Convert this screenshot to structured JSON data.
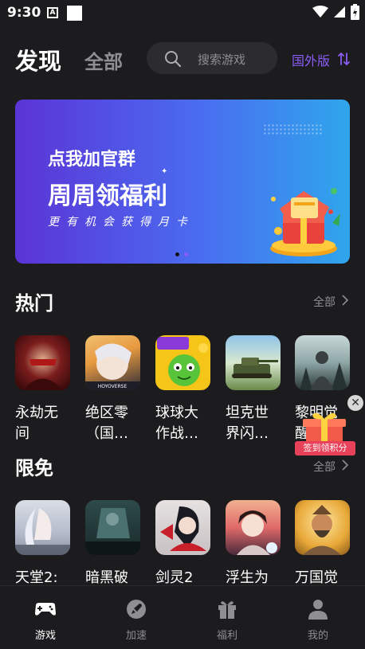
{
  "status_bar": {
    "time": "9:30",
    "a_icon_letter": "A"
  },
  "header": {
    "tab_discover": "发现",
    "tab_all": "全部",
    "search_placeholder": "搜索游戏",
    "region": "国外版"
  },
  "banner": {
    "line1": "点我加官群",
    "line2": "周周领福利",
    "line3": "更有机会获得月卡",
    "pager_count": 2,
    "pager_active": 1
  },
  "sections": {
    "hot": {
      "title": "热门",
      "more": "全部",
      "games": [
        {
          "name": "永劫无\n间",
          "icon": "naraka-icon"
        },
        {
          "name": "绝区零\n（国…",
          "icon": "zzz-icon"
        },
        {
          "name": "球球大\n作战…",
          "icon": "battle-of-balls-icon"
        },
        {
          "name": "坦克世\n界闪…",
          "icon": "tank-blitz-icon"
        },
        {
          "name": "黎明觉\n醒",
          "icon": "dawn-icon"
        }
      ]
    },
    "free": {
      "title": "限免",
      "more": "全部",
      "games": [
        {
          "name": "天堂2:",
          "icon": "lineage2-icon"
        },
        {
          "name": "暗黑破",
          "icon": "diablo-icon"
        },
        {
          "name": "剑灵2",
          "icon": "blade-soul2-icon"
        },
        {
          "name": "浮生为",
          "icon": "fusheng-icon"
        },
        {
          "name": "万国觉",
          "icon": "rise-kingdoms-icon"
        }
      ]
    }
  },
  "floating_ad": {
    "text": "签到领积分"
  },
  "bottom_nav": [
    {
      "label": "游戏",
      "icon": "gamepad-icon",
      "active": true
    },
    {
      "label": "加速",
      "icon": "rocket-icon",
      "active": false
    },
    {
      "label": "福利",
      "icon": "gift-icon",
      "active": false
    },
    {
      "label": "我的",
      "icon": "user-icon",
      "active": false
    }
  ],
  "colors": {
    "accent": "#8b5cf6",
    "background": "#1c1c1e",
    "muted": "#8e8e93"
  }
}
